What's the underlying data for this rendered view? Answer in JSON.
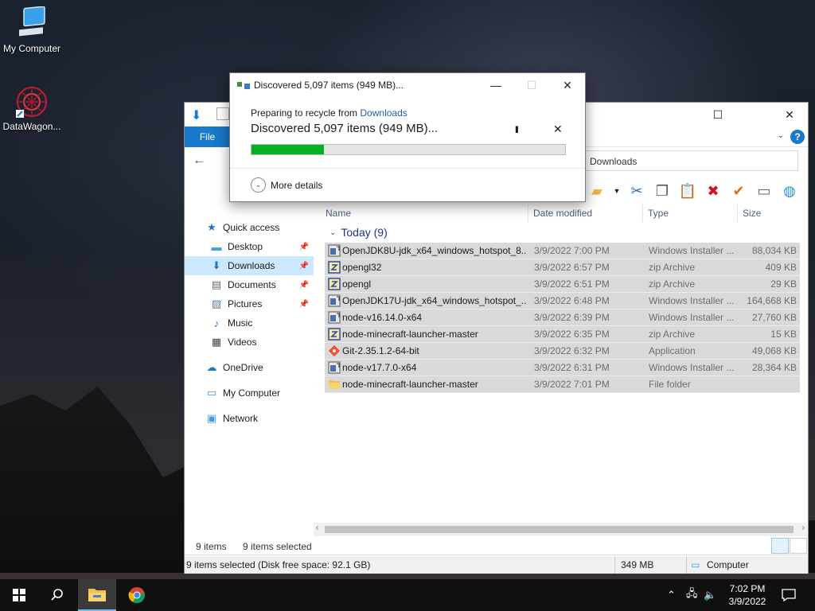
{
  "desktop": {
    "icons": [
      {
        "label": "My Computer"
      },
      {
        "label": "DataWagon..."
      }
    ]
  },
  "dialog": {
    "title": "Discovered 5,097 items (949 MB)...",
    "prep_prefix": "Preparing to recycle from ",
    "prep_link": "Downloads",
    "status": "Discovered 5,097 items (949 MB)...",
    "pause_glyph": "II",
    "close_glyph": "✕",
    "progress_fraction": 0.23,
    "more_details": "More details"
  },
  "explorer": {
    "file_tab": "File",
    "help": "?",
    "address": "Downloads",
    "nav": {
      "quick_access": "Quick access",
      "items": [
        {
          "label": "Desktop",
          "pinned": true
        },
        {
          "label": "Downloads",
          "pinned": true,
          "selected": true
        },
        {
          "label": "Documents",
          "pinned": true
        },
        {
          "label": "Pictures",
          "pinned": true
        },
        {
          "label": "Music",
          "pinned": false
        },
        {
          "label": "Videos",
          "pinned": false
        }
      ],
      "onedrive": "OneDrive",
      "my_computer": "My Computer",
      "network": "Network"
    },
    "columns": {
      "name": "Name",
      "date": "Date modified",
      "type": "Type",
      "size": "Size"
    },
    "group": "Today (9)",
    "files": [
      {
        "name": "OpenJDK8U-jdk_x64_windows_hotspot_8...",
        "date": "3/9/2022 7:00 PM",
        "type": "Windows Installer ...",
        "size": "88,034 KB",
        "icon": "installer-icon"
      },
      {
        "name": "opengl32",
        "date": "3/9/2022 6:57 PM",
        "type": "zip Archive",
        "size": "409 KB",
        "icon": "zip-icon"
      },
      {
        "name": "opengl",
        "date": "3/9/2022 6:51 PM",
        "type": "zip Archive",
        "size": "29 KB",
        "icon": "zip-icon"
      },
      {
        "name": "OpenJDK17U-jdk_x64_windows_hotspot_...",
        "date": "3/9/2022 6:48 PM",
        "type": "Windows Installer ...",
        "size": "164,668 KB",
        "icon": "installer-icon"
      },
      {
        "name": "node-v16.14.0-x64",
        "date": "3/9/2022 6:39 PM",
        "type": "Windows Installer ...",
        "size": "27,760 KB",
        "icon": "installer-icon"
      },
      {
        "name": "node-minecraft-launcher-master",
        "date": "3/9/2022 6:35 PM",
        "type": "zip Archive",
        "size": "15 KB",
        "icon": "zip-icon"
      },
      {
        "name": "Git-2.35.1.2-64-bit",
        "date": "3/9/2022 6:32 PM",
        "type": "Application",
        "size": "49,068 KB",
        "icon": "git-icon"
      },
      {
        "name": "node-v17.7.0-x64",
        "date": "3/9/2022 6:31 PM",
        "type": "Windows Installer ...",
        "size": "28,364 KB",
        "icon": "installer-icon"
      },
      {
        "name": "node-minecraft-launcher-master",
        "date": "3/9/2022 7:01 PM",
        "type": "File folder",
        "size": "",
        "icon": "folder-icon"
      }
    ],
    "status": {
      "items": "9 items",
      "selected": "9 items selected",
      "disk": "9 items selected (Disk free space: 92.1 GB)",
      "total": "349 MB",
      "location": "Computer"
    }
  },
  "taskbar": {
    "time": "7:02 PM",
    "date": "3/9/2022"
  },
  "colors": {
    "accent": "#1979ca",
    "progress": "#06b025",
    "selection": "#cce8ff",
    "selected_row": "#d9d9d9"
  }
}
